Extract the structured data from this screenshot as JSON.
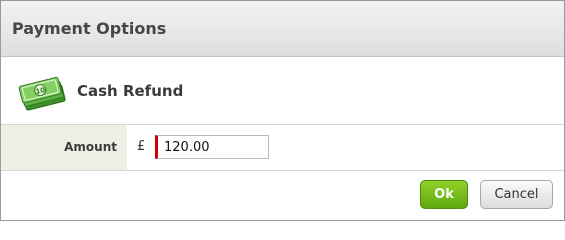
{
  "dialog": {
    "title": "Payment Options"
  },
  "payment_method": {
    "icon": "cash-money-icon",
    "label": "Cash Refund"
  },
  "amount": {
    "label": "Amount",
    "currency_symbol": "£",
    "value": "120.00"
  },
  "buttons": {
    "ok_label": "Ok",
    "cancel_label": "Cancel"
  },
  "colors": {
    "ok_button": "#6cbb14",
    "required_marker": "#cc0000",
    "label_cell_bg": "#eef0e6"
  }
}
